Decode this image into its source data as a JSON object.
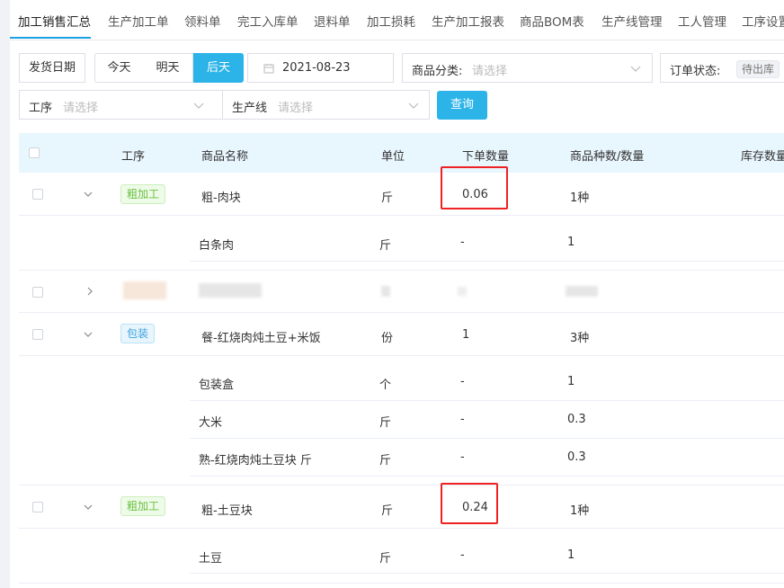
{
  "tabs": [
    "加工销售汇总",
    "生产加工单",
    "领料单",
    "完工入库单",
    "退料单",
    "加工损耗",
    "生产加工报表",
    "商品BOM表",
    "生产线管理",
    "工人管理",
    "工序设置"
  ],
  "filters": {
    "ship_date_label": "发货日期",
    "today": "今天",
    "tomorrow": "明天",
    "day_after": "后天",
    "date_value": "2021-08-23",
    "category_label": "商品分类:",
    "category_placeholder": "请选择",
    "order_status_label": "订单状态:",
    "order_status_tag": "待出库",
    "process_label": "工序",
    "process_placeholder": "请选择",
    "line_label": "生产线",
    "line_placeholder": "请选择",
    "query_button": "查询"
  },
  "table": {
    "headers": {
      "process": "工序",
      "name": "商品名称",
      "unit": "单位",
      "order_qty": "下单数量",
      "kinds_qty": "商品种数/数量",
      "stock": "库存数量"
    },
    "rows": [
      {
        "tag": "粗加工",
        "name": "粗-肉块",
        "unit": "斤",
        "qty": "0.06",
        "kinds": "1种"
      },
      {
        "name": "白条肉",
        "unit": "斤",
        "qty": "-",
        "kinds": "1"
      },
      {
        "tag": "包装",
        "name": "餐-红烧肉炖土豆+米饭",
        "unit": "份",
        "qty": "1",
        "kinds": "3种"
      },
      {
        "name": "包装盒",
        "unit": "个",
        "qty": "-",
        "kinds": "1"
      },
      {
        "name": "大米",
        "unit": "斤",
        "qty": "-",
        "kinds": "0.3"
      },
      {
        "name": "熟-红烧肉炖土豆块 斤",
        "unit": "斤",
        "qty": "-",
        "kinds": "0.3"
      },
      {
        "tag": "粗加工",
        "name": "粗-土豆块",
        "unit": "斤",
        "qty": "0.24",
        "kinds": "1种"
      },
      {
        "name": "土豆",
        "unit": "斤",
        "qty": "-",
        "kinds": "1"
      }
    ]
  },
  "colors": {
    "accent": "#2cb4e8",
    "header_bg": "#e8f6fd",
    "highlight": "#e22222",
    "tag_green": "#6abf40",
    "tag_blue": "#3aa3dc"
  }
}
